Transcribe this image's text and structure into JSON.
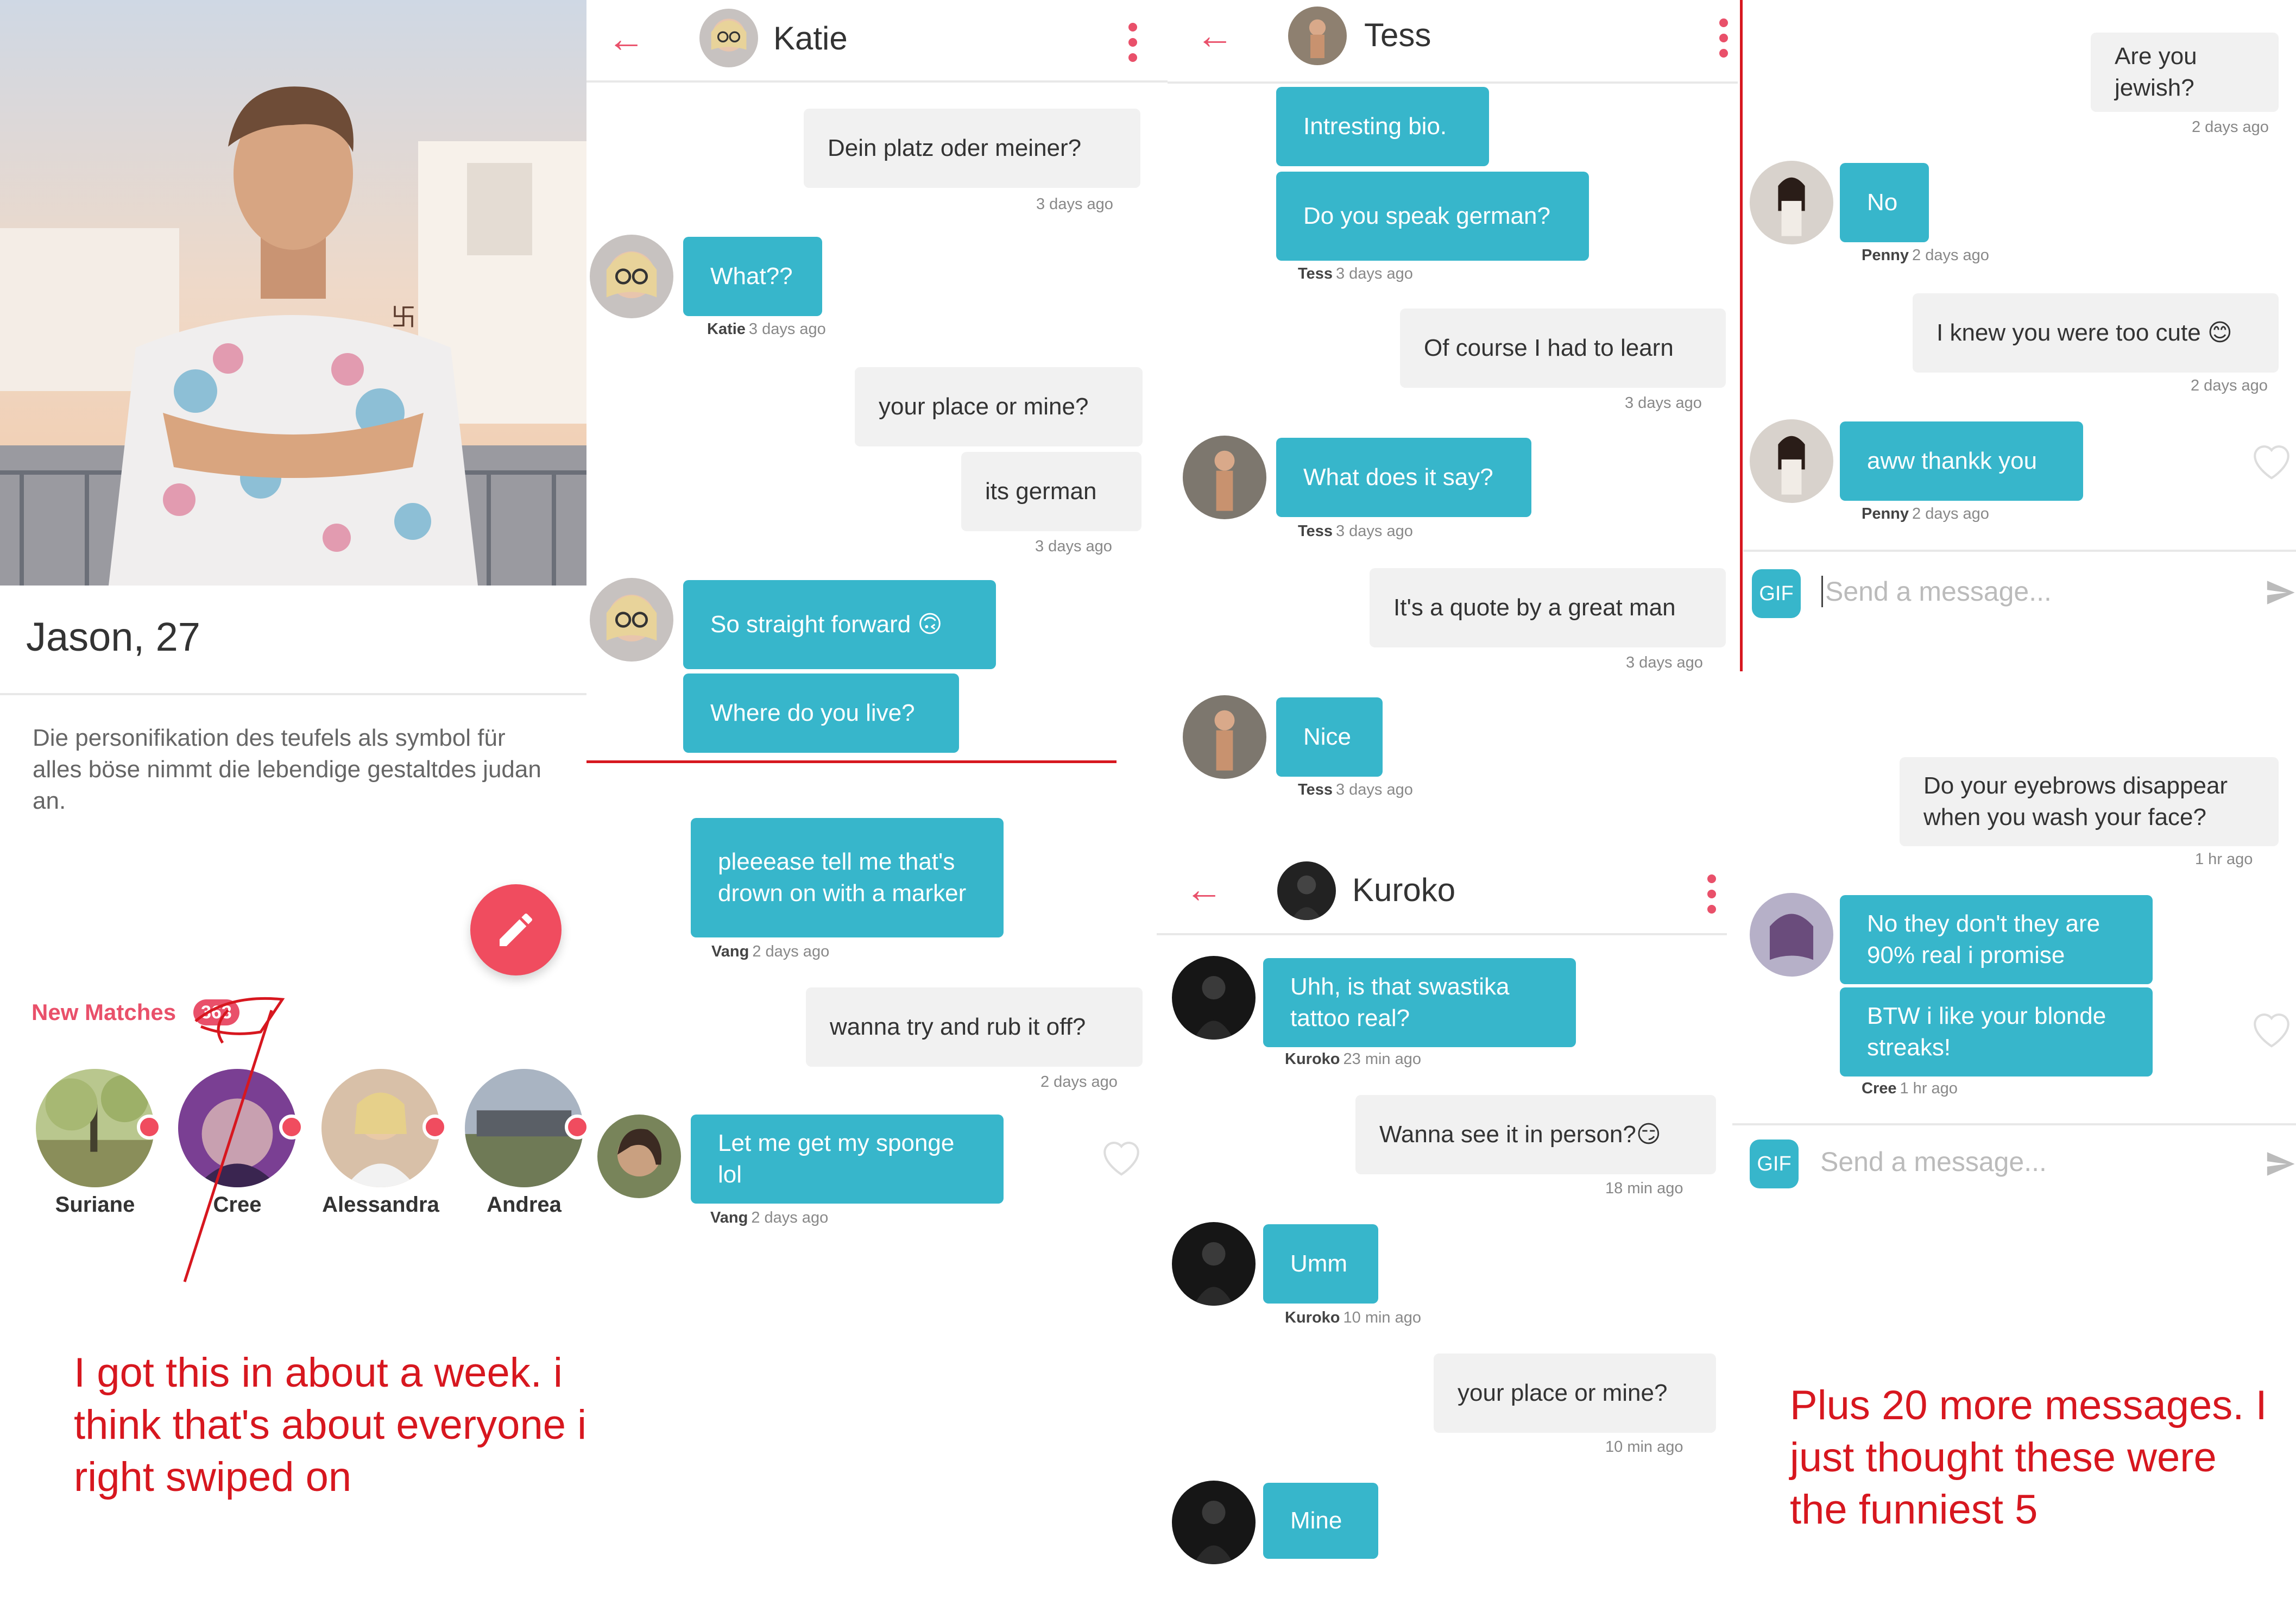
{
  "profile": {
    "name_age": "Jason, 27",
    "bio": "Die personifikation des teufels als symbol für alles böse nimmt die lebendige gestaltdes judan an.",
    "edit_icon": "pencil-icon",
    "new_matches_label": "New Matches",
    "new_matches_count": "363",
    "matches": [
      "Suriane",
      "Cree",
      "Alessandra",
      "Andrea"
    ],
    "annotation": "I got this in about a week. i think that's about everyone i right swiped on"
  },
  "katie": {
    "header_name": "Katie",
    "messages": [
      {
        "text": "Dein platz oder meiner?"
      },
      {
        "meta": "3 days ago"
      },
      {
        "text": "What??"
      },
      {
        "sender": "Katie",
        "meta": "3 days ago"
      },
      {
        "text": "your place or mine?"
      },
      {
        "text": "its german"
      },
      {
        "meta": "3 days ago"
      },
      {
        "text": "So straight forward 🙃"
      },
      {
        "text": "Where do you live?"
      }
    ]
  },
  "vang": {
    "messages": [
      {
        "text": "pleeease tell me that's drown on with a marker"
      },
      {
        "sender": "Vang",
        "meta": "2 days ago"
      },
      {
        "text": "wanna try and rub it off?"
      },
      {
        "meta": "2 days ago"
      },
      {
        "text": "Let me get my sponge lol"
      },
      {
        "sender": "Vang",
        "meta": "2 days ago"
      }
    ]
  },
  "tess": {
    "header_name": "Tess",
    "messages": [
      {
        "text": "Intresting bio."
      },
      {
        "text": "Do you speak german?"
      },
      {
        "sender": "Tess",
        "meta": "3 days ago"
      },
      {
        "text": "Of course I had to learn"
      },
      {
        "meta": "3 days ago"
      },
      {
        "text": "What does it say?"
      },
      {
        "sender": "Tess",
        "meta": "3 days ago"
      },
      {
        "text": "It's a quote by a great man"
      },
      {
        "meta": "3 days ago"
      },
      {
        "text": "Nice"
      },
      {
        "sender": "Tess",
        "meta": "3 days ago"
      }
    ]
  },
  "kuroko": {
    "header_name": "Kuroko",
    "messages": [
      {
        "text": "Uhh, is that swastika tattoo real?"
      },
      {
        "sender": "Kuroko",
        "meta": "23 min ago"
      },
      {
        "text": "Wanna see it in person?😏"
      },
      {
        "meta": "18 min ago"
      },
      {
        "text": "Umm"
      },
      {
        "sender": "Kuroko",
        "meta": "10 min ago"
      },
      {
        "text": "your place or mine?"
      },
      {
        "meta": "10 min ago"
      },
      {
        "text": "Mine"
      }
    ]
  },
  "penny": {
    "messages": [
      {
        "text": "Are you jewish?"
      },
      {
        "meta": "2 days ago"
      },
      {
        "text": "No"
      },
      {
        "sender": "Penny",
        "meta": "2 days ago"
      },
      {
        "text": "I knew you were too cute 😊"
      },
      {
        "meta": "2 days ago"
      },
      {
        "text": "aww thankk you"
      },
      {
        "sender": "Penny",
        "meta": "2 days ago"
      }
    ],
    "gif_label": "GIF",
    "input_placeholder": "Send a message..."
  },
  "cree": {
    "messages": [
      {
        "text": "Do your eyebrows disappear when you wash your face?"
      },
      {
        "meta": "1 hr ago"
      },
      {
        "text": "No they don't they are 90% real i promise"
      },
      {
        "text": "BTW i like your blonde streaks!"
      },
      {
        "sender": "Cree",
        "meta": "1 hr ago"
      }
    ],
    "gif_label": "GIF",
    "input_placeholder": "Send a message...",
    "annotation": "Plus 20 more messages. I just thought these were the funniest 5"
  },
  "icons": {
    "back": "back-arrow-icon",
    "menu": "more-vertical-icon",
    "send": "send-icon",
    "heart": "heart-icon"
  },
  "colors": {
    "accent_blue": "#37b6cb",
    "brand_pink": "#e9506a",
    "annotation_red": "#d7171f",
    "gray_bubble": "#f1f1f1"
  }
}
